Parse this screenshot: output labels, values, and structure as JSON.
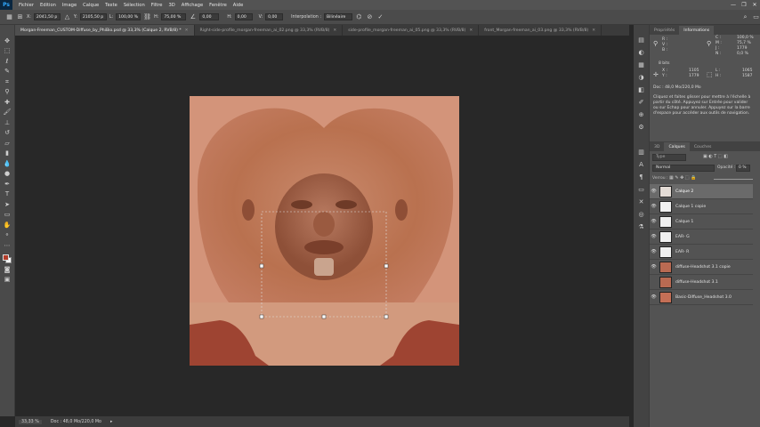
{
  "app": {
    "logo": "Ps"
  },
  "menu": [
    "Fichier",
    "Edition",
    "Image",
    "Calque",
    "Texte",
    "Sélection",
    "Filtre",
    "3D",
    "Affichage",
    "Fenêtre",
    "Aide"
  ],
  "window_controls": [
    "—",
    "❐",
    "✕"
  ],
  "options": {
    "x_label": "X:",
    "x_value": "2041,50 p",
    "y_label": "Y:",
    "y_value": "2105,50 p",
    "l_label": "L:",
    "l_value": "100,00 %",
    "h_label": "H:",
    "h_value": "75,00 %",
    "angle_value": "0,00",
    "hskew_label": "H:",
    "hskew_value": "0,00",
    "vskew_label": "V:",
    "vskew_value": "0,00",
    "interp_label": "Interpolation :",
    "interp_value": "Bilinéaire"
  },
  "doc_tabs": [
    {
      "label": "Morgan-Freeman_CUSTOM-Diffuse_by_PhiBio.psd @ 33,3% (Calque 2, RVB/8) *",
      "active": true
    },
    {
      "label": "Right-side-profile_morgan-freeman_ai_02.png @ 33,3% (RVB/8)",
      "active": false
    },
    {
      "label": "side-profile_morgan-freeman_ai_05.png @ 33,3% (RVB/8)",
      "active": false
    },
    {
      "label": "front_Morgan-freeman_ai_03.png @ 33,3% (RVB/8)",
      "active": false
    }
  ],
  "tab_close": "✕",
  "status": {
    "zoom": "33,33 %",
    "doc": "Doc : 48,0 Mo/220,0 Mo"
  },
  "info_panel": {
    "tabs": [
      "Propriétés",
      "Informations"
    ],
    "r_label": "R :",
    "g_label": "V :",
    "b_label": "B :",
    "c_label": "C :",
    "m_label": "M :",
    "y_label": "J :",
    "k_label": "N :",
    "c_value": "100,0 %",
    "m_value": "75,7 %",
    "y_value": "1779",
    "k_value": "0,0 %",
    "bits": "8 bits",
    "x_label": "X :",
    "x_value": "1105",
    "y_label2": "Y :",
    "w_label": "L :",
    "w_value": "1065",
    "h_label": "H :",
    "h_value": "1587",
    "doc": "Doc : 48,0 Mo/220,0 Mo",
    "help": "Cliquez et faites glisser pour mettre à l'échelle à partir du côté. Appuyez sur Entrée pour valider ou sur Echap pour annuler. Appuyez sur la barre d'espace pour accéder aux outils de navigation."
  },
  "layers_panel": {
    "tabs": [
      "3D",
      "Calques",
      "Couches"
    ],
    "filter_label": "Type",
    "blend_mode": "Normal",
    "opacity_label": "Opacité :",
    "opacity_value": "0 %",
    "lock_label": "Verrou :",
    "layers": [
      {
        "name": "Calque 2",
        "selected": true,
        "thumb": "#e4dcd6",
        "visible": true
      },
      {
        "name": "Calque 1 copie",
        "selected": false,
        "thumb": "#f0f0f0",
        "visible": true
      },
      {
        "name": "Calque 1",
        "selected": false,
        "thumb": "#f0f0f0",
        "visible": true
      },
      {
        "name": "EAR- G",
        "selected": false,
        "thumb": "#f0f0f0",
        "visible": true
      },
      {
        "name": "EAR- R",
        "selected": false,
        "thumb": "#f0f0f0",
        "visible": true
      },
      {
        "name": "diffuse-Headshot 3.1 copie",
        "selected": false,
        "thumb": "#b96a52",
        "visible": true
      },
      {
        "name": "diffuse-Headshot 3.1",
        "selected": false,
        "thumb": "#b96a52",
        "visible": false
      },
      {
        "name": "Basic-Diffuse_Headshot 3.0",
        "selected": false,
        "thumb": "#c46f56",
        "visible": true
      }
    ]
  },
  "colors": {
    "skin_light": "#d3947a",
    "skin_base": "#c47d62",
    "skin_dark": "#a85c43",
    "shirt_red": "#9e4432"
  }
}
